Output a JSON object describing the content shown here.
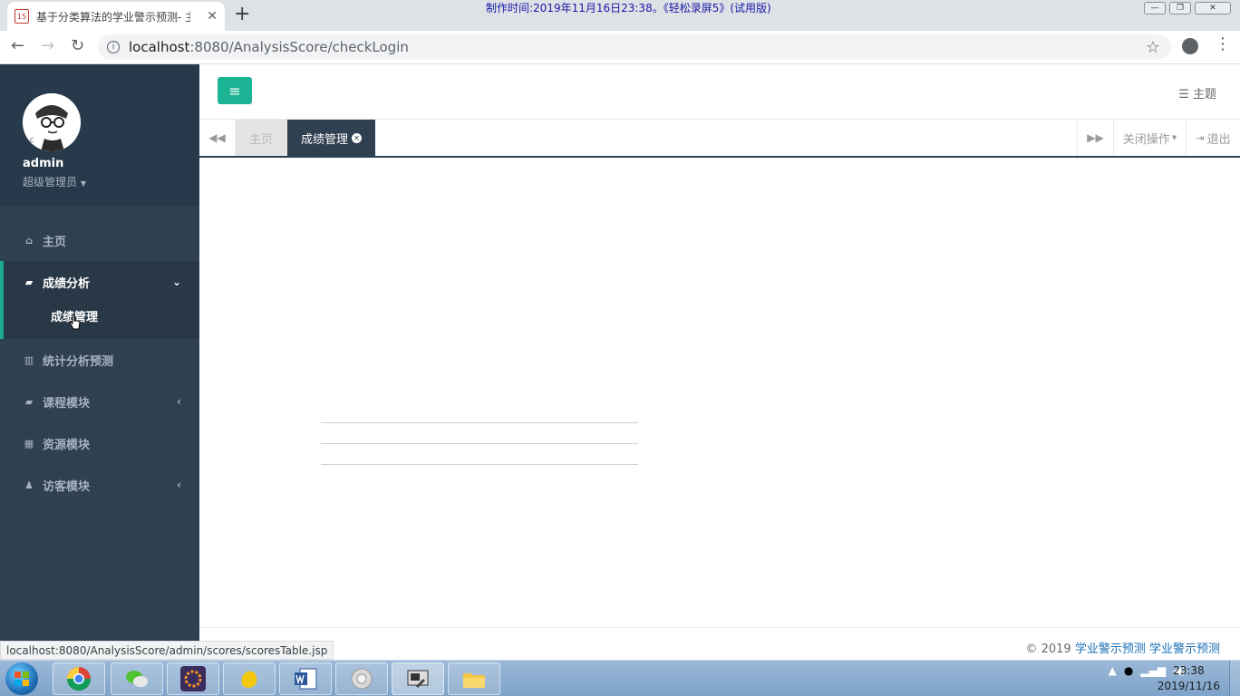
{
  "browser": {
    "tab_title": "基于分类算法的学业警示预测- 主",
    "favicon_text": "15",
    "new_tab": "+",
    "recorder_overlay": "制作时间:2019年11月16日23:38。《轻松录屏5》(试用版)",
    "url_host": "localhost",
    "url_rest": ":8080/AnalysisScore/checkLogin",
    "status_url": "localhost:8080/AnalysisScore/admin/scores/scoresTable.jsp"
  },
  "sidebar": {
    "username": "admin",
    "role": "超级管理员",
    "items": [
      {
        "label": "主页",
        "icon": "home-icon"
      },
      {
        "label": "成绩分析",
        "icon": "book-icon",
        "sub": [
          {
            "label": "成绩管理"
          }
        ]
      },
      {
        "label": "统计分析预测",
        "icon": "bar-chart-icon"
      },
      {
        "label": "课程模块",
        "icon": "book-icon"
      },
      {
        "label": "资源模块",
        "icon": "table-icon"
      },
      {
        "label": "访客模块",
        "icon": "user-icon"
      }
    ]
  },
  "header": {
    "theme_label": "主题"
  },
  "content_tabs": {
    "home": "主页",
    "active": "成绩管理",
    "close_ops": "关闭操作",
    "logout": "退出"
  },
  "footer": {
    "copyright": "© 2019",
    "link1": "学业警示预测",
    "link2": "学业警示预测"
  },
  "taskbar": {
    "time": "23:38",
    "date": "2019/11/16"
  },
  "colors": {
    "sidebar_bg": "#2f4050",
    "accent": "#1ab394"
  }
}
